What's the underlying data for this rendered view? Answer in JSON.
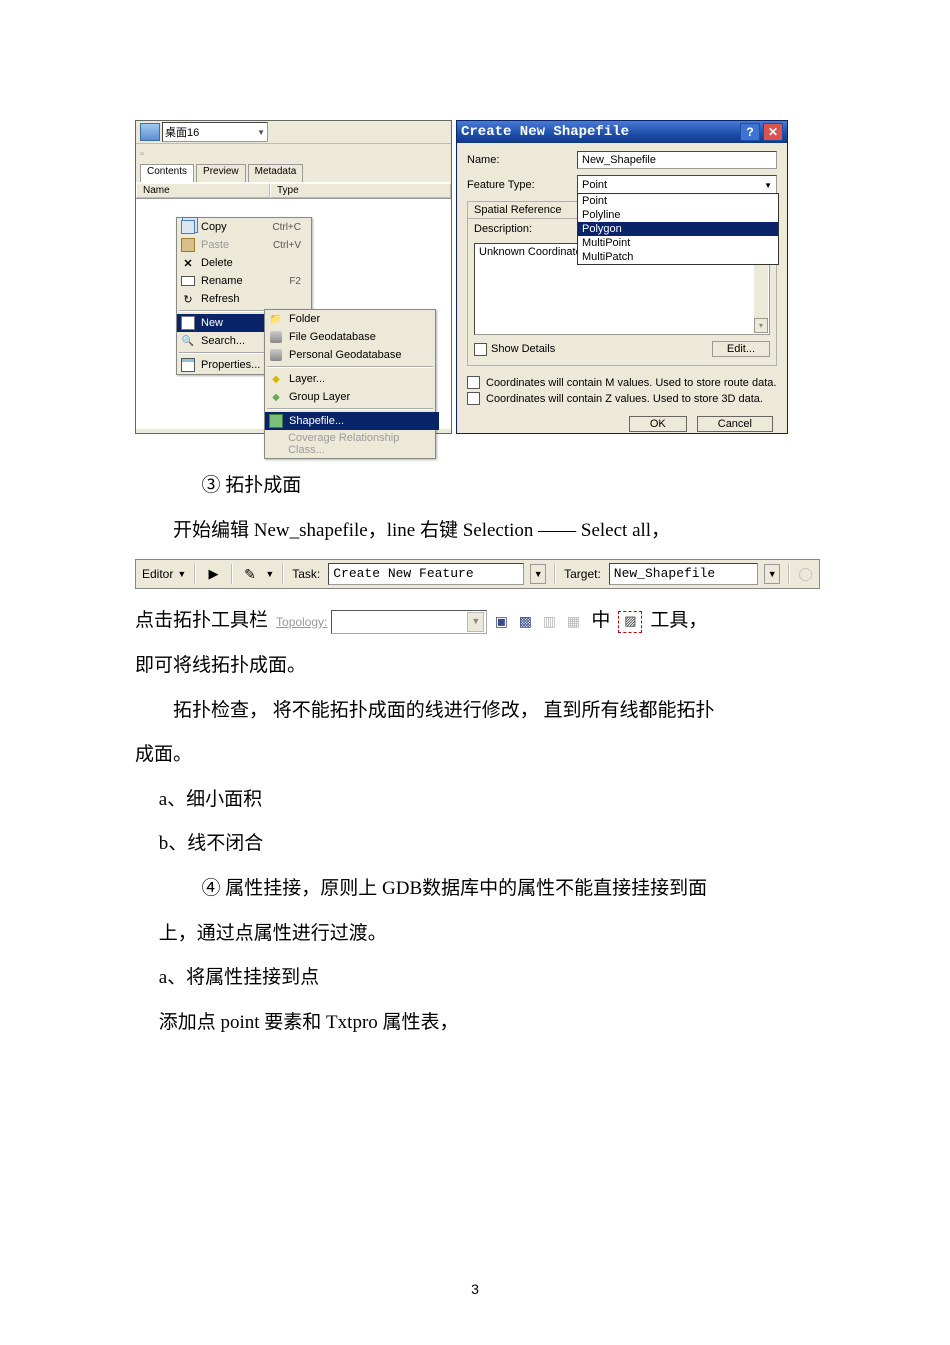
{
  "page_number": "3",
  "left_panel": {
    "address": "桌面16",
    "tabs": {
      "contents": "Contents",
      "preview": "Preview",
      "metadata": "Metadata"
    },
    "columns": {
      "name": "Name",
      "type": "Type"
    },
    "ctx_menu": {
      "copy": "Copy",
      "copy_sc": "Ctrl+C",
      "paste": "Paste",
      "paste_sc": "Ctrl+V",
      "delete": "Delete",
      "rename": "Rename",
      "rename_sc": "F2",
      "refresh": "Refresh",
      "new": "New",
      "search": "Search...",
      "properties": "Properties..."
    },
    "new_submenu": {
      "folder": "Folder",
      "file_gdb": "File Geodatabase",
      "personal_gdb": "Personal Geodatabase",
      "layer": "Layer...",
      "group_layer": "Group Layer",
      "shapefile": "Shapefile...",
      "coverage_rel": "Coverage Relationship Class..."
    }
  },
  "right_panel": {
    "title": "Create New Shapefile",
    "lbl_name": "Name:",
    "name_value": "New_Shapefile",
    "lbl_feature_type": "Feature Type:",
    "feature_type_selected": "Point",
    "feature_type_options": [
      "Point",
      "Polyline",
      "Polygon",
      "MultiPoint",
      "MultiPatch"
    ],
    "group_title": "Spatial Reference",
    "desc_label": "Description:",
    "desc_text": "Unknown Coordinate System",
    "show_details": "Show Details",
    "edit": "Edit...",
    "chk_m": "Coordinates will contain M values. Used to store route data.",
    "chk_z": "Coordinates will contain Z values. Used to store 3D data.",
    "ok": "OK",
    "cancel": "Cancel"
  },
  "toolbar1": {
    "editor": "Editor",
    "task_label": "Task:",
    "task_value": "Create New Feature",
    "target_label": "Target:",
    "target_value": "New_Shapefile"
  },
  "toolbar2": {
    "topology_label": "Topology:"
  },
  "text": {
    "sec3_title": "③ 拓扑成面",
    "p1": "开始编辑 New_shapefile，line 右键 Selection —— Select all，",
    "p2_prefix": "点击拓扑工具栏",
    "p2_mid": "中",
    "p2_suffix": "工具，",
    "p3": "即可将线拓扑成面。",
    "p4": "拓扑检查，   将不能拓扑成面的线进行修改，   直到所有线都能拓扑",
    "p4b": "成面。",
    "la": "a、细小面积",
    "lb": "b、线不闭合",
    "sec4": "④ 属性挂接，原则上   GDB数据库中的属性不能直接挂接到面",
    "sec4b": "上，通过点属性进行过渡。",
    "la2": "a、将属性挂接到点",
    "p5": "添加点 point  要素和 Txtpro  属性表，"
  }
}
